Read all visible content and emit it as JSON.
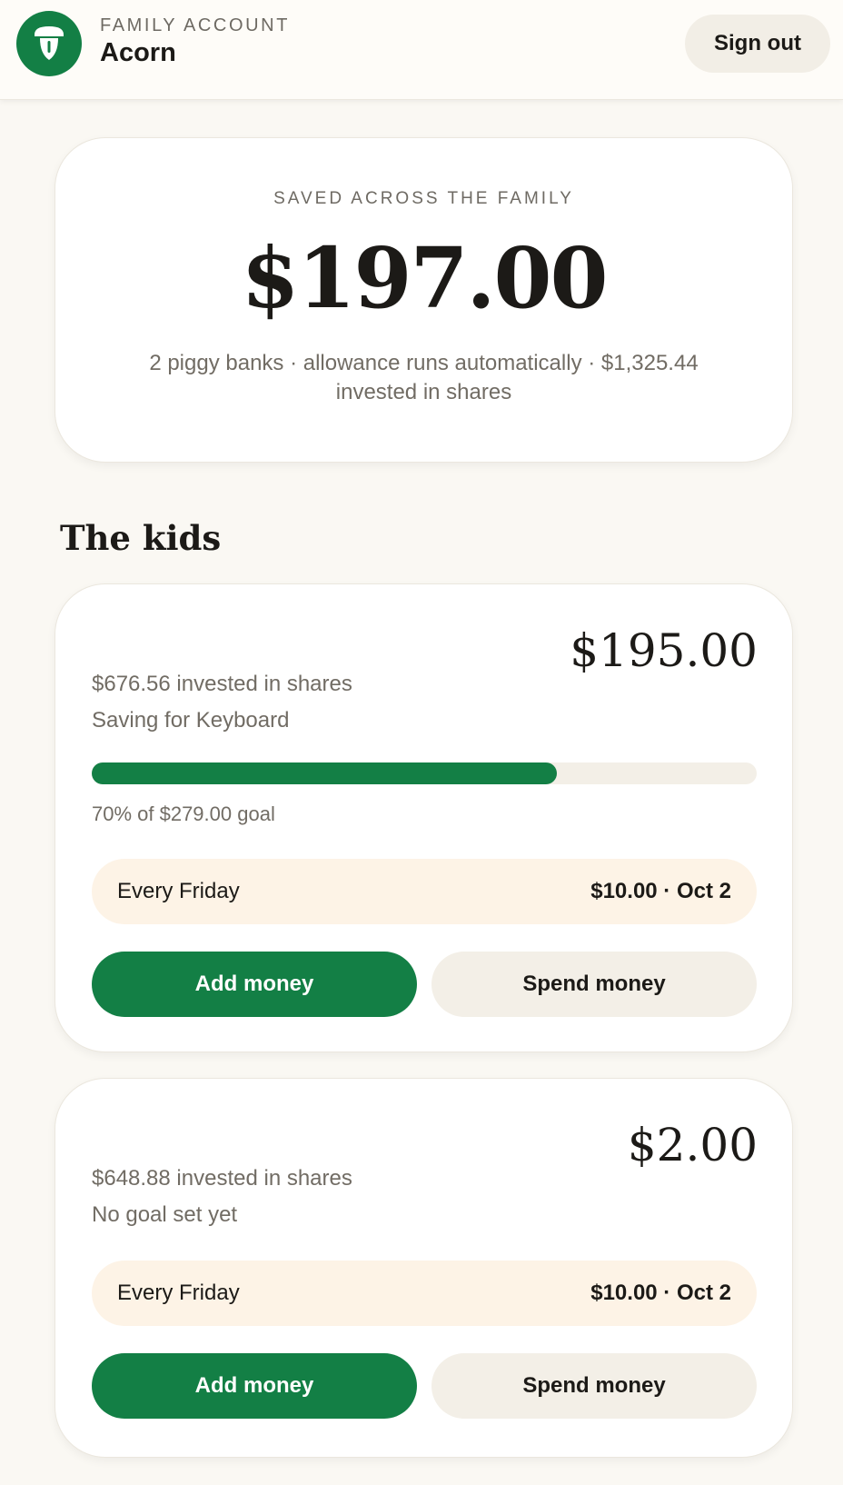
{
  "header": {
    "kicker": "FAMILY ACCOUNT",
    "name": "Acorn",
    "logo_icon": "acorn-icon",
    "signout_label": "Sign out"
  },
  "summary": {
    "kicker": "SAVED ACROSS THE FAMILY",
    "total": "$197.00",
    "note": "2 piggy banks · allowance runs automatically · $1,325.44 invested in shares"
  },
  "kids_section": {
    "title": "The kids"
  },
  "kids": [
    {
      "balance": "$195.00",
      "invested": "$676.56 invested in shares",
      "goal_text": "Saving for Keyboard",
      "progress_fraction": 0.7,
      "progress_text": "70% of $279.00 goal",
      "allowance_label": "Every Friday",
      "allowance_detail": "$10.00 · Oct 2",
      "add_label": "Add money",
      "spend_label": "Spend money"
    },
    {
      "balance": "$2.00",
      "invested": "$648.88 invested in shares",
      "goal_text": "No goal set yet",
      "allowance_label": "Every Friday",
      "allowance_detail": "$10.00 · Oct 2",
      "add_label": "Add money",
      "spend_label": "Spend money"
    }
  ],
  "colors": {
    "brand_green": "#137f45",
    "background": "#faf8f3",
    "allowance_bg": "#fdf3e6",
    "secondary_button_bg": "#f3efe7"
  }
}
